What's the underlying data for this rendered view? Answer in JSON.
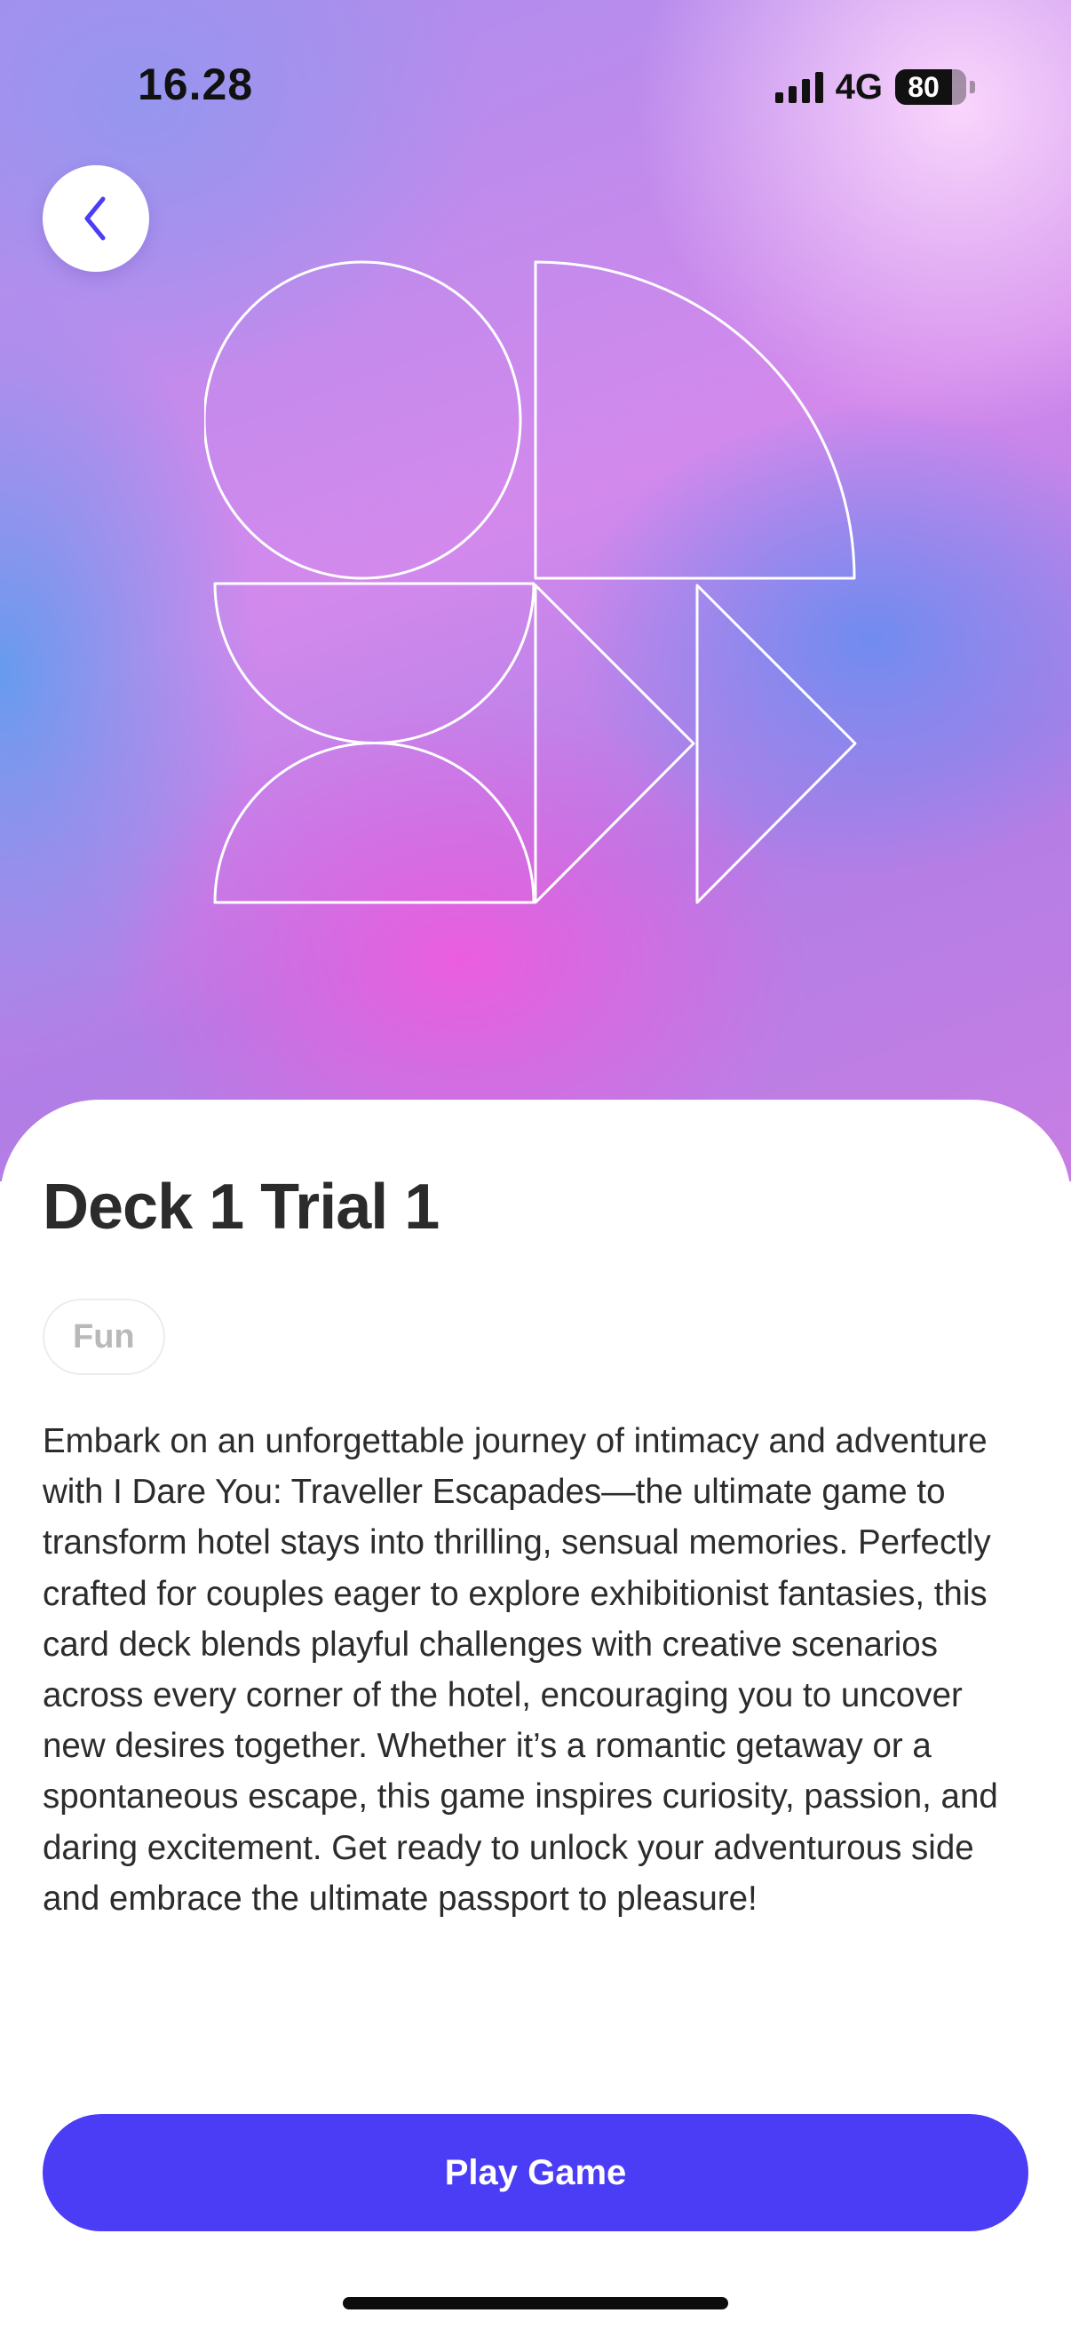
{
  "status_bar": {
    "time": "16.28",
    "network": "4G",
    "battery": "80",
    "battery_level_percent": 80
  },
  "nav": {
    "back_icon": "chevron-left-icon"
  },
  "hero": {
    "artwork": "geometric-outline-shapes"
  },
  "deck": {
    "title": "Deck 1 Trial 1",
    "tag": "Fun",
    "description": "Embark on an unforgettable journey of intimacy and adventure with I Dare You: Traveller Escapades—the ultimate game to transform hotel stays into thrilling, sensual memories. Perfectly crafted for couples eager to explore exhibitionist fantasies, this card deck blends playful challenges with creative scenarios across every corner of the hotel, encouraging you to uncover new desires together. Whether it’s a romantic getaway or a spontaneous escape, this game inspires curiosity, passion, and daring excitement. Get ready to unlock your adventurous side and embrace the ultimate passport to pleasure!"
  },
  "actions": {
    "play_label": "Play Game"
  },
  "colors": {
    "accent": "#4b3cf5",
    "title_text": "#2b2b2b",
    "tag_text": "#b9b9b9"
  }
}
